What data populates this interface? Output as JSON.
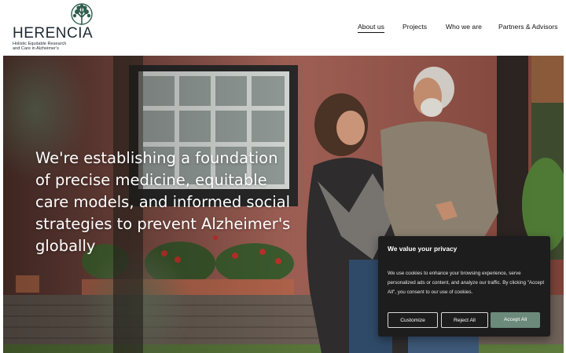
{
  "header": {
    "logo_word": "HERENCIA",
    "logo_tagline_1": "Holistic Equitable Research",
    "logo_tagline_2": "and Care in Alzheimer's",
    "nav": [
      {
        "label": "About us",
        "active": true
      },
      {
        "label": "Projects",
        "active": false
      },
      {
        "label": "Who we are",
        "active": false
      },
      {
        "label": "Partners & Advisors",
        "active": false
      }
    ]
  },
  "hero": {
    "headline": "We're establishing a foundation of precise medicine, equitable care models, and informed social strategies to prevent Alzheimer's globally"
  },
  "cookie": {
    "title": "We value your privacy",
    "body": "We use cookies to enhance your browsing experience, serve personalized ads or content, and analyze our traffic. By clicking \"Accept All\", you consent to our use of cookies.",
    "customize": "Customize",
    "reject": "Reject All",
    "accept": "Accept All"
  },
  "colors": {
    "accent": "#6c8a7a",
    "logo_tree": "#2f5d4e",
    "cookie_bg": "#1d1d1d"
  }
}
